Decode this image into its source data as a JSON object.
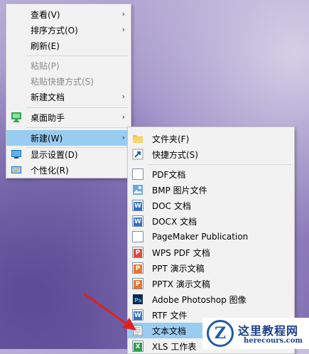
{
  "context_menu": {
    "items": [
      {
        "label": "查看(V)",
        "has_submenu": true,
        "enabled": true
      },
      {
        "label": "排序方式(O)",
        "has_submenu": true,
        "enabled": true
      },
      {
        "label": "刷新(E)",
        "has_submenu": false,
        "enabled": true
      },
      {
        "label": "粘贴(P)",
        "has_submenu": false,
        "enabled": false
      },
      {
        "label": "粘贴快捷方式(S)",
        "has_submenu": false,
        "enabled": false
      },
      {
        "label": "新建文档",
        "has_submenu": true,
        "enabled": true
      },
      {
        "label": "桌面助手",
        "has_submenu": true,
        "enabled": true,
        "icon": "desktop-assistant-icon"
      },
      {
        "label": "新建(W)",
        "has_submenu": true,
        "enabled": true,
        "highlighted": true
      },
      {
        "label": "显示设置(D)",
        "has_submenu": false,
        "enabled": true,
        "icon": "display-settings-icon"
      },
      {
        "label": "个性化(R)",
        "has_submenu": false,
        "enabled": true,
        "icon": "personalize-icon"
      }
    ]
  },
  "new_submenu": {
    "items": [
      {
        "label": "文件夹(F)",
        "icon": "folder-icon"
      },
      {
        "label": "快捷方式(S)",
        "icon": "shortcut-icon"
      },
      {
        "label": "PDF文档",
        "icon": "pdf-document-icon"
      },
      {
        "label": "BMP 图片文件",
        "icon": "bmp-image-icon"
      },
      {
        "label": "DOC 文档",
        "icon": "doc-document-icon"
      },
      {
        "label": "DOCX 文档",
        "icon": "docx-document-icon"
      },
      {
        "label": "PageMaker Publication",
        "icon": "pagemaker-icon"
      },
      {
        "label": "WPS PDF 文档",
        "icon": "wps-pdf-icon"
      },
      {
        "label": "PPT 演示文稿",
        "icon": "ppt-icon"
      },
      {
        "label": "PPTX 演示文稿",
        "icon": "pptx-icon"
      },
      {
        "label": "Adobe Photoshop 图像",
        "icon": "photoshop-icon"
      },
      {
        "label": "RTF 文件",
        "icon": "rtf-icon"
      },
      {
        "label": "文本文档",
        "icon": "text-document-icon",
        "highlighted": true
      },
      {
        "label": "XLS 工作表",
        "icon": "xls-icon"
      }
    ]
  },
  "watermark": {
    "logo_letter": "Z",
    "title": "这里教程网",
    "url": "herecours.com"
  },
  "colors": {
    "highlight": "#99ccf0",
    "annotation_arrow": "#e02020"
  }
}
